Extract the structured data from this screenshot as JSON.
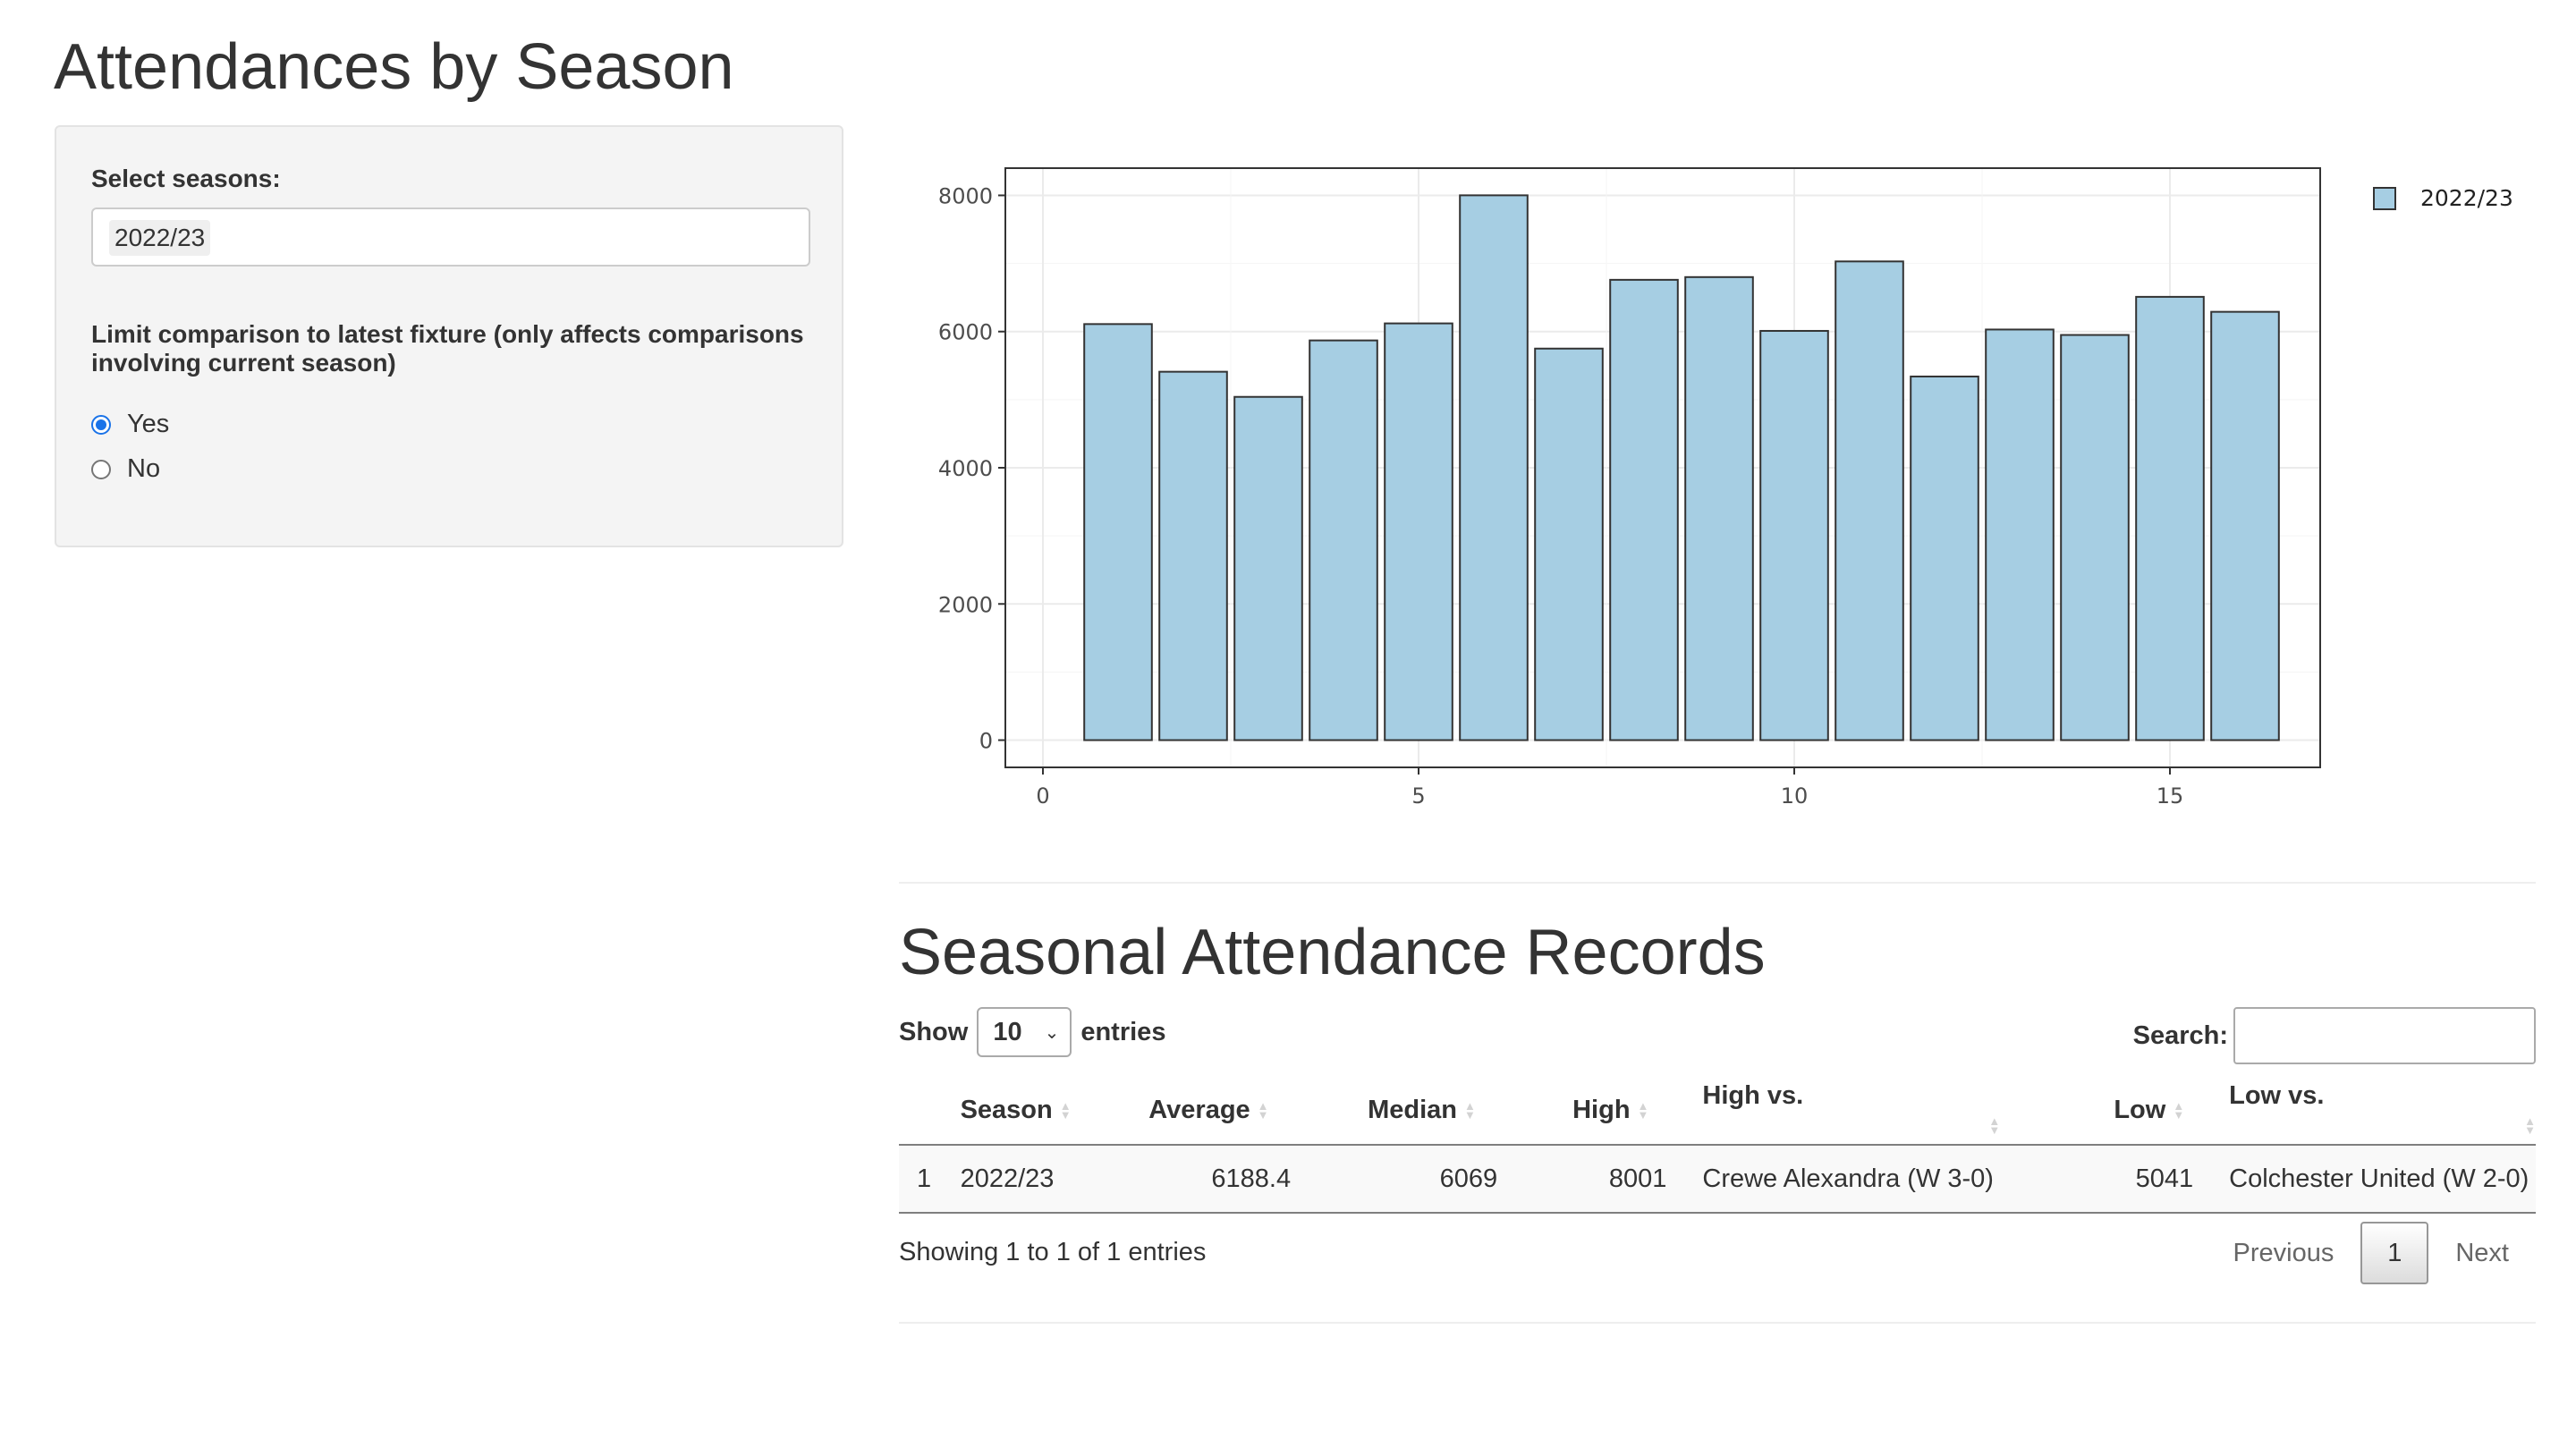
{
  "page": {
    "title": "Attendances by Season"
  },
  "sidebar": {
    "select_label": "Select seasons:",
    "selected_season": "2022/23",
    "limit_question": "Limit comparison to latest fixture (only affects comparisons involving current season)",
    "options": [
      {
        "label": "Yes",
        "checked": true
      },
      {
        "label": "No",
        "checked": false
      }
    ]
  },
  "chart_data": {
    "type": "bar",
    "x": [
      1,
      2,
      3,
      4,
      5,
      6,
      7,
      8,
      9,
      10,
      11,
      12,
      13,
      14,
      15,
      16
    ],
    "series": [
      {
        "name": "2022/23",
        "values": [
          6110,
          5410,
          5041,
          5870,
          6120,
          8001,
          5750,
          6760,
          6800,
          6010,
          7030,
          5340,
          6030,
          5950,
          6510,
          6290
        ]
      }
    ],
    "xlim": [
      -0.5,
      17
    ],
    "ylim": [
      -400,
      8400
    ],
    "xticks": [
      0,
      5,
      10,
      15
    ],
    "yticks": [
      0,
      2000,
      4000,
      6000,
      8000
    ],
    "grid": true,
    "legend": "right",
    "colors": {
      "bar_fill": "#a6cee3",
      "bar_stroke": "#333333"
    }
  },
  "records": {
    "title": "Seasonal Attendance Records",
    "show_label": "Show",
    "entries_value": "10",
    "entries_label": "entries",
    "search_label": "Search:",
    "search_value": "",
    "columns": [
      "",
      "Season",
      "Average",
      "Median",
      "High",
      "High vs.",
      "Low",
      "Low vs."
    ],
    "rows": [
      {
        "index": "1",
        "season": "2022/23",
        "average": "6188.4",
        "median": "6069",
        "high": "8001",
        "high_vs": "Crewe Alexandra (W 3-0)",
        "low": "5041",
        "low_vs": "Colchester United (W 2-0)"
      }
    ],
    "info": "Showing 1 to 1 of 1 entries",
    "pagination": {
      "previous": "Previous",
      "current": "1",
      "next": "Next"
    }
  }
}
